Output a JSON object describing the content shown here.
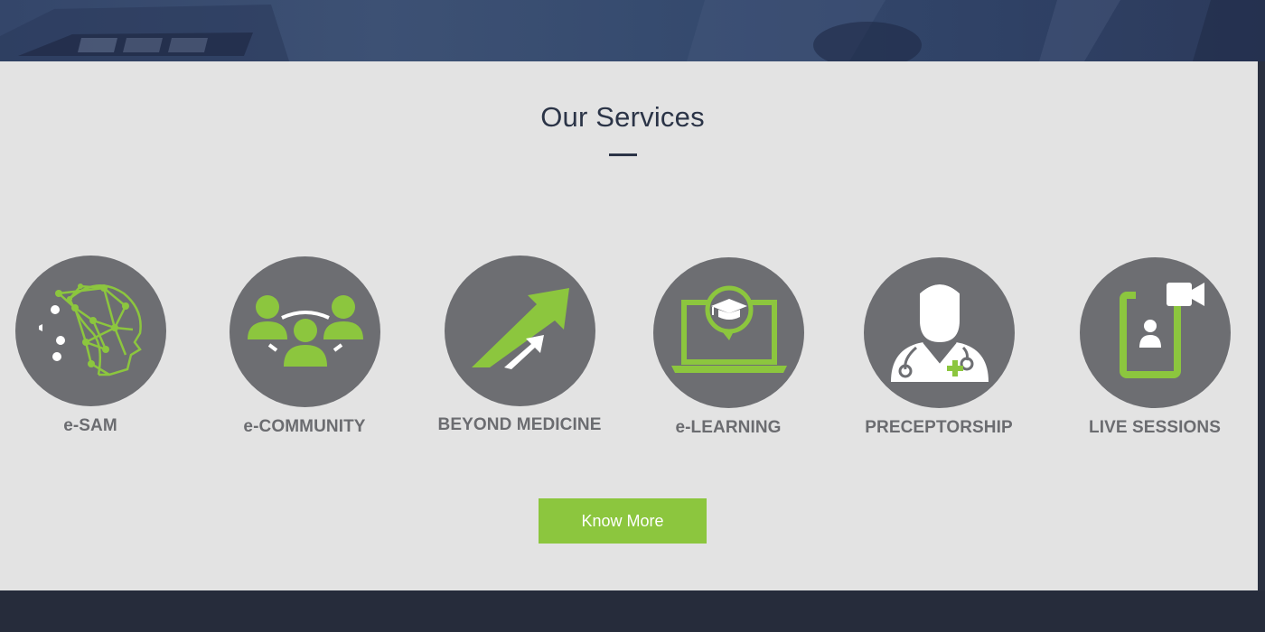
{
  "section": {
    "title": "Our Services"
  },
  "services": [
    {
      "label": "e-SAM",
      "icon": "brain-network-head-icon"
    },
    {
      "label": "e-COMMUNITY",
      "icon": "community-group-icon"
    },
    {
      "label": "BEYOND MEDICINE",
      "icon": "growth-arrows-icon"
    },
    {
      "label": "e-LEARNING",
      "icon": "laptop-graduation-icon"
    },
    {
      "label": "PRECEPTORSHIP",
      "icon": "doctor-stethoscope-icon"
    },
    {
      "label": "LIVE SESSIONS",
      "icon": "video-call-phone-icon"
    }
  ],
  "cta": {
    "label": "Know More"
  },
  "colors": {
    "accent": "#8cc63e",
    "circle": "#6d6e72",
    "section_bg": "#e3e3e3",
    "title": "#2b3447",
    "dark_band": "#262c3b"
  }
}
